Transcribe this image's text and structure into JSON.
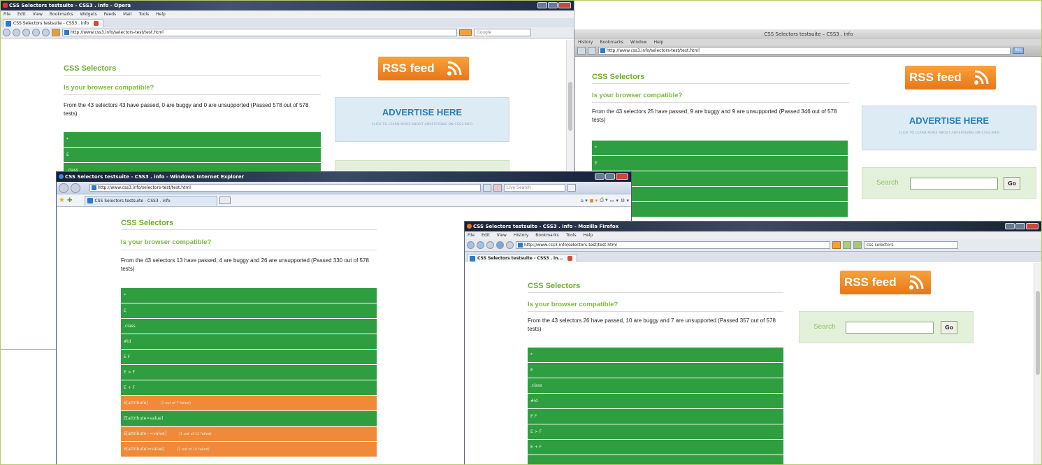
{
  "colors": {
    "pass": "#2f9e40",
    "buggy": "#f08a3a",
    "site_green": "#6aab2e",
    "rss_orange": "#f39427",
    "advertise_blue": "#2a7eb8"
  },
  "opera": {
    "title": "CSS Selectors testsuite - CSS3 . info - Opera",
    "menu": [
      "File",
      "Edit",
      "View",
      "Bookmarks",
      "Widgets",
      "Feeds",
      "Mail",
      "Tools",
      "Help"
    ],
    "tab": "CSS Selectors testsuite - CSS3 . info",
    "url": "http://www.css3.info/selectors-test/test.html",
    "search_placeholder": "Google",
    "page": {
      "heading": "CSS Selectors",
      "subheading": "Is your browser compatible?",
      "summary": "From the 43 selectors 43 have passed, 0 are buggy and 0 are unsupported (Passed 578 out of 578 tests)",
      "rows": [
        {
          "label": "*",
          "status": "pass"
        },
        {
          "label": "E",
          "status": "pass"
        },
        {
          "label": ".class",
          "status": "pass"
        }
      ],
      "rss": "RSS feed",
      "advertise": "ADVERTISE HERE",
      "advertise_small": "CLICK TO LEARN MORE ABOUT ADVERTISING ON CSS3.INFO"
    }
  },
  "safari": {
    "title": "CSS Selectors testsuite – CSS3 . info",
    "menu": [
      "History",
      "Bookmarks",
      "Window",
      "Help"
    ],
    "url": "http://www.css3.info/selectors-test/test.html",
    "rss_button": "RSS",
    "page": {
      "heading": "CSS Selectors",
      "subheading": "Is your browser compatible?",
      "summary": "From the 43 selectors 25 have passed, 9 are buggy and 9 are unsupported (Passed 346 out of 578 tests)",
      "rows": [
        {
          "label": "*",
          "status": "pass"
        },
        {
          "label": "E",
          "status": "pass"
        },
        {
          "label": "",
          "status": "pass"
        },
        {
          "label": "",
          "status": "pass"
        },
        {
          "label": "",
          "status": "pass"
        }
      ],
      "rss": "RSS feed",
      "advertise": "ADVERTISE HERE",
      "advertise_small": "CLICK TO LEARN MORE ABOUT ADVERTISING ON CSS3.INFO",
      "search_label": "Search",
      "go": "Go"
    }
  },
  "ie": {
    "title": "CSS Selectors testsuite - CSS3 . info - Windows Internet Explorer",
    "url": "http://www.css3.info/selectors-test/test.html",
    "search_placeholder": "Live Search",
    "tab": "CSS Selectors testsuite - CSS3 . info",
    "page": {
      "heading": "CSS Selectors",
      "subheading": "Is your browser compatible?",
      "summary": "From the 43 selectors 13 have passed, 4 are buggy and 26 are unsupported (Passed 330 out of 578 tests)",
      "rows": [
        {
          "label": "*",
          "status": "pass",
          "note": ""
        },
        {
          "label": "E",
          "status": "pass",
          "note": ""
        },
        {
          "label": ".class",
          "status": "pass",
          "note": ""
        },
        {
          "label": "#id",
          "status": "pass",
          "note": ""
        },
        {
          "label": "E F",
          "status": "pass",
          "note": ""
        },
        {
          "label": "E > F",
          "status": "pass",
          "note": ""
        },
        {
          "label": "E + F",
          "status": "pass",
          "note": ""
        },
        {
          "label": "E[attribute]",
          "status": "buggy",
          "note": "(1 out of 7 failed)"
        },
        {
          "label": "E[attribute=value]",
          "status": "pass",
          "note": ""
        },
        {
          "label": "E[attribute~=value]",
          "status": "buggy",
          "note": "(1 out of 11 failed)"
        },
        {
          "label": "E[attribute|=value]",
          "status": "buggy",
          "note": "(1 out of 10 failed)"
        }
      ]
    }
  },
  "firefox": {
    "title": "CSS Selectors testsuite - CSS3 . info - Mozilla Firefox",
    "menu": [
      "File",
      "Edit",
      "View",
      "History",
      "Bookmarks",
      "Tools",
      "Help"
    ],
    "url": "http://www.css3.info/selectors-test/test.html",
    "search_value": "css selectors",
    "tab": "CSS Selectors testsuite - CSS3 . in...",
    "page": {
      "heading": "CSS Selectors",
      "subheading": "Is your browser compatible?",
      "summary": "From the 43 selectors 26 have passed, 10 are buggy and 7 are unsupported (Passed 357 out of 578 tests)",
      "rows": [
        {
          "label": "*",
          "status": "pass"
        },
        {
          "label": "E",
          "status": "pass"
        },
        {
          "label": ".class",
          "status": "pass"
        },
        {
          "label": "#id",
          "status": "pass"
        },
        {
          "label": "E F",
          "status": "pass"
        },
        {
          "label": "E > F",
          "status": "pass"
        },
        {
          "label": "E + F",
          "status": "pass"
        },
        {
          "label": "",
          "status": "pass"
        }
      ],
      "rss": "RSS feed",
      "search_label": "Search",
      "go": "Go"
    }
  }
}
